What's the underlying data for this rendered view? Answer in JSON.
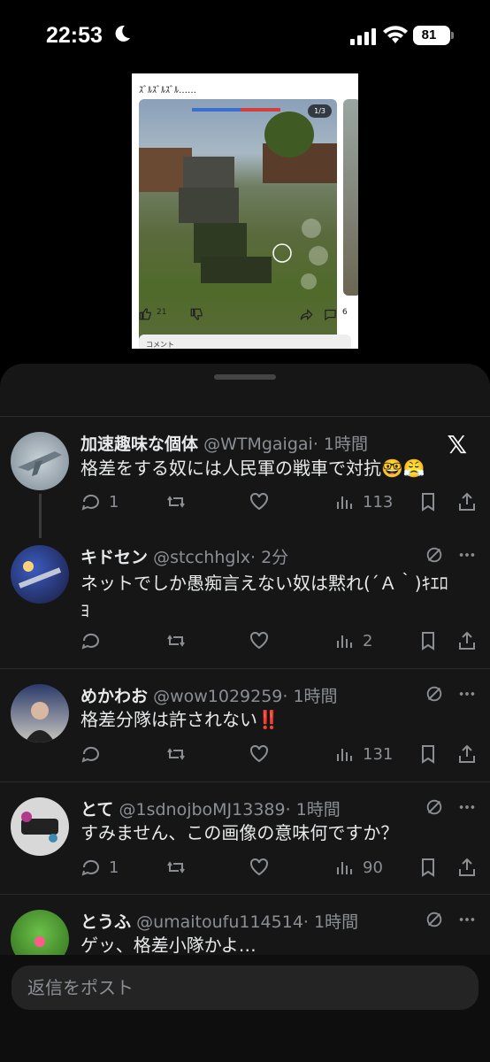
{
  "status_bar": {
    "time": "22:53",
    "battery": "81"
  },
  "preview": {
    "caption": "ｽﾞﾙｽﾞﾙｽﾞﾙ……",
    "image_counter": "1/3",
    "like_count": "21",
    "comment_count": "6",
    "comment_label": "コメント"
  },
  "tweets": [
    {
      "name": "加速趣味な個体",
      "handle": "@WTMgaigai",
      "time": "· 1時間",
      "text": "格差をする奴には人民軍の戦車で対抗🤓😤",
      "replies": "1",
      "views": "113"
    },
    {
      "name": "キドセン",
      "handle": "@stcchhglx",
      "time": "· 2分",
      "text": "ネットでしか愚痴言えない奴は黙れ(´Ａ｀)ｷｴﾛﾖ",
      "replies": "",
      "views": "2"
    },
    {
      "name": "めかわお",
      "handle": "@wow1029259",
      "time": "· 1時間",
      "text": "格差分隊は許されない‼️",
      "replies": "",
      "views": "131"
    },
    {
      "name": "とて",
      "handle": "@1sdnojboMJ13389",
      "time": "· 1時間",
      "text": "すみません、この画像の意味何ですか？",
      "replies": "1",
      "views": "90"
    },
    {
      "name": "とうふ",
      "handle": "@umaitoufu114514",
      "time": "· 1時間",
      "text": "ゲッ、格差小隊かよ…"
    }
  ],
  "reply_bar": {
    "placeholder": "返信をポスト"
  },
  "colors": {
    "background": "#000000",
    "sheet": "#161616",
    "text": "#e7e9ea",
    "muted": "#8b8f94",
    "emoji_red": "#e0245e"
  }
}
